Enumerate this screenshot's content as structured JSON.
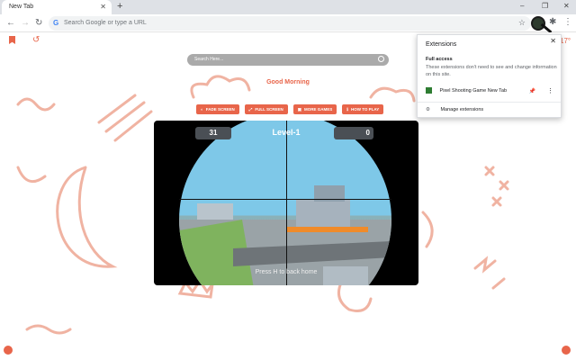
{
  "browser": {
    "tab_title": "New Tab",
    "tab_close": "✕",
    "new_tab": "+",
    "omnibox_placeholder": "Search Google or type a URL",
    "minimize": "–",
    "restore": "❐",
    "close": "✕"
  },
  "page": {
    "search_placeholder": "Search Here...",
    "greeting": "Good Morning",
    "temperature": "17°",
    "buttons": [
      {
        "label": "FADE SCREEN",
        "icon": "fade-icon"
      },
      {
        "label": "FULL SCREEN",
        "icon": "fullscreen-icon"
      },
      {
        "label": "MORE GAMES",
        "icon": "gamepad-icon"
      },
      {
        "label": "HOW TO PLAY",
        "icon": "info-icon"
      }
    ]
  },
  "game": {
    "ammo": "31",
    "level": "Level-1",
    "kills": "0",
    "hint": "Press H to back home"
  },
  "extensions_popup": {
    "title": "Extensions",
    "section": "Full access",
    "description": "These extensions don't need to see and change information on this site.",
    "extension_name": "Pixel Shooting Game New Tab",
    "manage_label": "Manage extensions"
  },
  "colors": {
    "accent": "#e8654a",
    "toolbar": "#dee1e6"
  }
}
